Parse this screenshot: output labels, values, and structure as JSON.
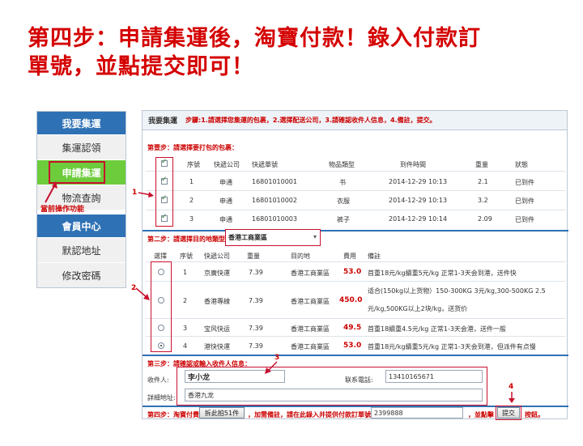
{
  "headline": {
    "line1": "第四步：申請集運後，淘寶付款！錄入付款訂",
    "line2": "單號，並點提交即可！"
  },
  "nav": {
    "header1": "我要集運",
    "items1": [
      "集運認領",
      "申請集運",
      "物流查詢"
    ],
    "active_note": "當前操作功能",
    "header2": "會員中心",
    "items2": [
      "默認地址",
      "修改密碼"
    ]
  },
  "panel": {
    "title": "我要集運",
    "steps_hint": "步驟:1.請選擇您集運的包裹，2.選擇配送公司，3.請確認收件人信息，4.備註，提交。"
  },
  "step1": {
    "label": "第壹步：請選擇要打包的包裹：",
    "headers": [
      "序號",
      "快遞公司",
      "快遞單號",
      "物品類型",
      "到件時間",
      "重量",
      "狀態"
    ],
    "rows": [
      {
        "no": "1",
        "company": "申通",
        "tracking": "16801010001",
        "type": "书",
        "time": "2014-12-29 10:13",
        "weight": "2.1",
        "status": "已到件"
      },
      {
        "no": "2",
        "company": "申通",
        "tracking": "16801010002",
        "type": "衣服",
        "time": "2014-12-29 10:13",
        "weight": "3.2",
        "status": "已到件"
      },
      {
        "no": "3",
        "company": "申通",
        "tracking": "16801010003",
        "type": "裤子",
        "time": "2014-12-29 10:14",
        "weight": "2.09",
        "status": "已到件"
      }
    ]
  },
  "step2": {
    "label": "第二步：請選擇目的地類型",
    "destination_selected": "香港工商業區",
    "headers": [
      "選擇",
      "序號",
      "快遞公司",
      "重量",
      "目的地",
      "費用",
      "備註"
    ],
    "rows": [
      {
        "no": "1",
        "company": "京廣快運",
        "weight": "7.39",
        "dest": "香港工商業區",
        "fee": "53.0",
        "note1": "首重18元/kg續重5元/kg 正常1-3天会到港，送件快",
        "note2": "",
        "note3": ""
      },
      {
        "no": "2",
        "company": "香港專線",
        "weight": "7.39",
        "dest": "香港工商業區",
        "fee": "450.0",
        "note1": "适合(150kg以上货物）150-300KG 3元/kg,300-500KG 2.5",
        "note2": "元/kg,500KG以上2块/kg，送货价",
        "note3": ""
      },
      {
        "no": "3",
        "company": "宝风快运",
        "weight": "7.39",
        "dest": "香港工商業區",
        "fee": "49.5",
        "note1": "首重18續重4.5元/kg 正常1-3天会港，送件一般",
        "note2": "",
        "note3": ""
      },
      {
        "no": "4",
        "company": "港快快運",
        "weight": "7.39",
        "dest": "香港工商業區",
        "fee": "53.0",
        "note1": "首重18元/kg續重5元/kg 正常1-3天会到港，但派件有点慢",
        "note2": "",
        "note3": ""
      }
    ]
  },
  "step3": {
    "label": "第三步：請確認或輸入收件人信息：",
    "recipient_label": "收件人:",
    "recipient_value": "李小龙",
    "phone_label": "联系電話:",
    "phone_value": "13410165671",
    "address_label": "詳細地址:",
    "address_value": "香港九龙"
  },
  "step4": {
    "label": "第四步：淘寶付費",
    "pay_button": "拆此拍51件",
    "hint": "，加需備註，請在此錄入并提供付款訂單號",
    "order_value": "2399888",
    "confirm_text": "，並點擊",
    "submit_button": "提交",
    "tail": "按鈕。"
  },
  "annotations": [
    "1",
    "2",
    "3",
    "4"
  ],
  "colors": {
    "headline": "#d40000",
    "nav_blue": "#2f71b5",
    "nav_active": "#6dcc3c",
    "annotation_red": "#c8102e"
  }
}
